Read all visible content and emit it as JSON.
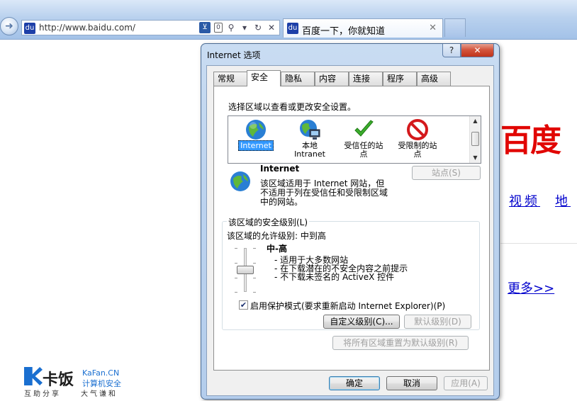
{
  "browser": {
    "back_icon": "back-arrow-icon",
    "url": "http://www.baidu.com/",
    "tab_title": "百度一下，你就知道",
    "tab_close": "✕",
    "favicon_label": "du",
    "compat_glyph": "⊻",
    "shield_glyph": "0"
  },
  "page": {
    "logo_text": "百度",
    "nav_links": [
      "视频",
      "地"
    ],
    "more_link": "更多>>"
  },
  "watermark": {
    "name": "卡饭",
    "domain": "KaFan.CN",
    "subtitle": "计算机安全",
    "slogan_left": "互助分享",
    "slogan_right": "大气谦和"
  },
  "dialog": {
    "title": "Internet 选项",
    "help_label": "?",
    "close_label": "✕",
    "tabs": [
      {
        "label": "常规",
        "active": false
      },
      {
        "label": "安全",
        "active": true
      },
      {
        "label": "隐私",
        "active": false
      },
      {
        "label": "内容",
        "active": false
      },
      {
        "label": "连接",
        "active": false
      },
      {
        "label": "程序",
        "active": false
      },
      {
        "label": "高级",
        "active": false
      }
    ],
    "zone_prompt": "选择区域以查看或更改安全设置。",
    "zones": [
      {
        "label": "Internet",
        "selected": true
      },
      {
        "label": "本地\nIntranet",
        "selected": false
      },
      {
        "label": "受信任的站\n点",
        "selected": false
      },
      {
        "label": "受限制的站\n点",
        "selected": false
      }
    ],
    "zone_info": {
      "title": "Internet",
      "description_line1": "该区域适用于 Internet 网站，但",
      "description_line2": "不适用于列在受信任和受限制区域",
      "description_line3": "中的网站。",
      "sites_button": "站点(S)"
    },
    "security_level": {
      "group_label": "该区域的安全级别(L)",
      "allowed_label": "该区域的允许级别: 中到高",
      "level_name": "中-高",
      "bullets": [
        "- 适用于大多数网站",
        "- 在下载潜在的不安全内容之前提示",
        "- 不下载未签名的 ActiveX 控件"
      ],
      "slider_level": "中-高",
      "protected_mode_label": "启用保护模式(要求重新启动 Internet Explorer)(P)",
      "protected_mode_checked": true,
      "custom_level_button": "自定义级别(C)...",
      "default_level_button": "默认级别(D)"
    },
    "reset_all_button": "将所有区域重置为默认级别(R)",
    "ok_button": "确定",
    "cancel_button": "取消",
    "apply_button": "应用(A)"
  }
}
